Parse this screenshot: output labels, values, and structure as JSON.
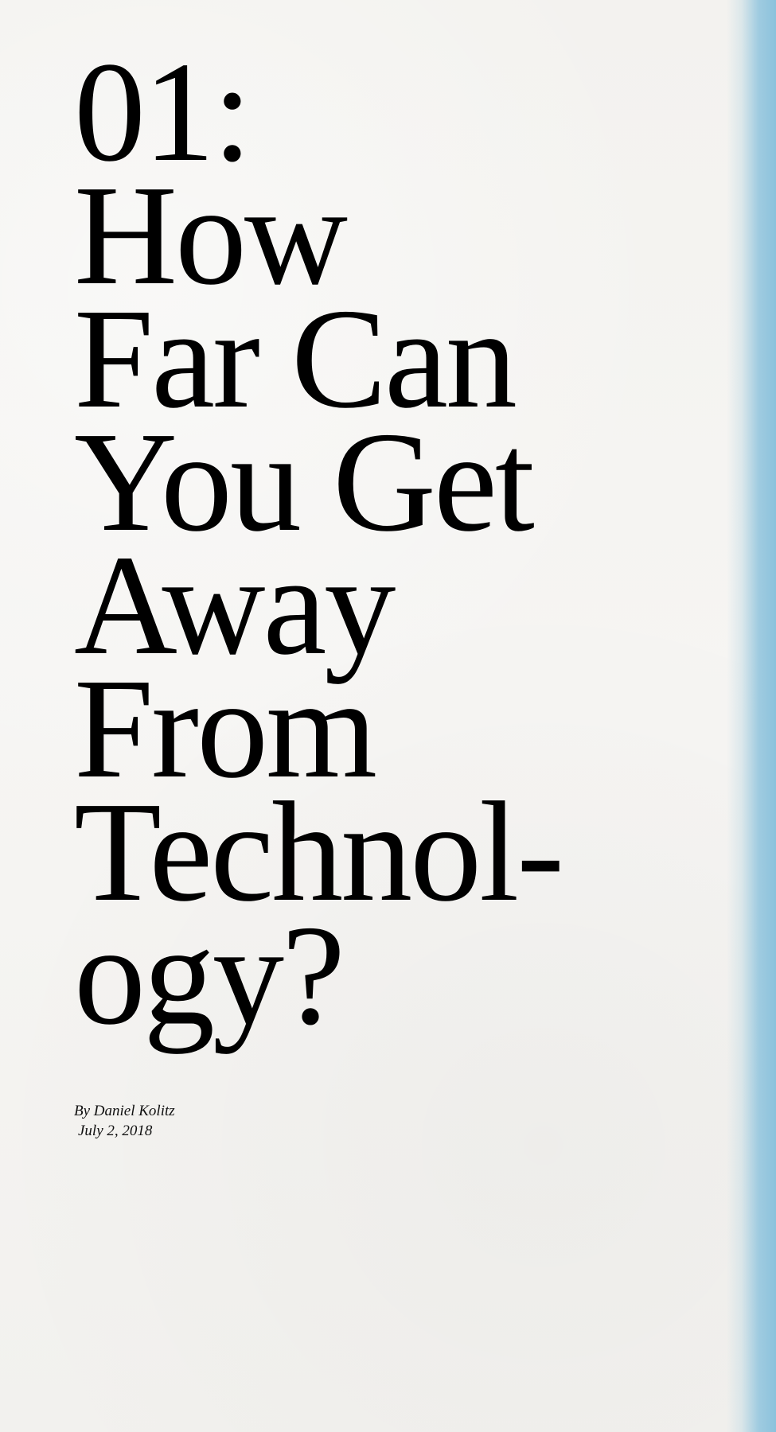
{
  "article": {
    "title_lines": [
      "01:",
      "How",
      "Far Can",
      "You Get",
      "Away",
      "From",
      "Technol-",
      "ogy?"
    ],
    "author": "By Daniel Kolitz",
    "date": "July 2, 2018"
  },
  "colors": {
    "paper": "#f4f3f0",
    "text": "#000000",
    "edge_accent": "#8cc2dc"
  }
}
